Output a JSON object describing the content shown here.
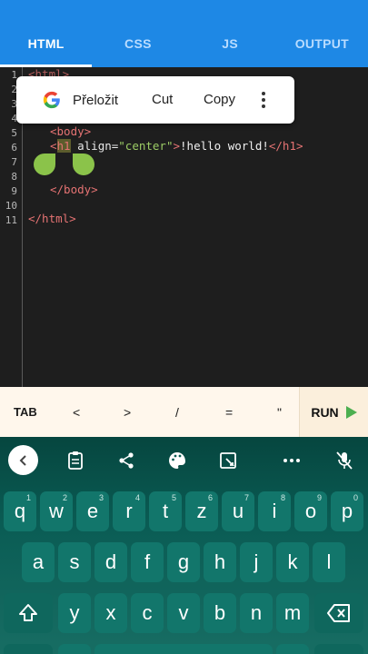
{
  "tabs": [
    {
      "label": "HTML",
      "active": true
    },
    {
      "label": "CSS",
      "active": false
    },
    {
      "label": "JS",
      "active": false
    },
    {
      "label": "OUTPUT",
      "active": false
    }
  ],
  "editor": {
    "line_numbers": [
      "1",
      "2",
      "3",
      "4",
      "5",
      "6",
      "7",
      "8",
      "9",
      "10",
      "11"
    ],
    "line1": "<html>",
    "line5": "<body>",
    "line6_open": "<",
    "line6_selected": "h1",
    "line6_attr": " align=",
    "line6_value": "\"center\"",
    "line6_close": ">",
    "line6_text": "!hello world!",
    "line6_end": "</h1>",
    "line9": "</body>",
    "line11": "</html>"
  },
  "context_menu": {
    "translate": "Přeložit",
    "cut": "Cut",
    "copy": "Copy"
  },
  "quick_keys": {
    "tab": "TAB",
    "lt": "<",
    "gt": ">",
    "slash": "/",
    "eq": "=",
    "quote": "\"",
    "run": "RUN"
  },
  "keyboard": {
    "row1": [
      {
        "k": "q",
        "h": "1"
      },
      {
        "k": "w",
        "h": "2"
      },
      {
        "k": "e",
        "h": "3"
      },
      {
        "k": "r",
        "h": "4"
      },
      {
        "k": "t",
        "h": "5"
      },
      {
        "k": "z",
        "h": "6"
      },
      {
        "k": "u",
        "h": "7"
      },
      {
        "k": "i",
        "h": "8"
      },
      {
        "k": "o",
        "h": "9"
      },
      {
        "k": "p",
        "h": "0"
      }
    ],
    "row2": [
      "a",
      "s",
      "d",
      "f",
      "g",
      "h",
      "j",
      "k",
      "l"
    ],
    "row3": [
      "y",
      "x",
      "c",
      "v",
      "b",
      "n",
      "m"
    ]
  },
  "colors": {
    "accent": "#1e88e5",
    "tag": "#e57373",
    "string": "#9ccc65",
    "run": "#4caf50",
    "keyboard": "#0a5c54"
  }
}
